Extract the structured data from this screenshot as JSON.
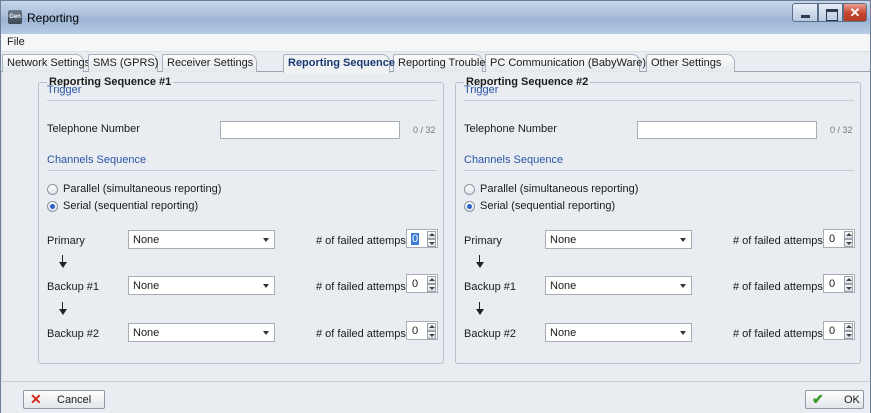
{
  "window": {
    "title": "Reporting",
    "app_icon_text": "Gen"
  },
  "menu": {
    "file": "File"
  },
  "tabs": [
    "Network Settings",
    "SMS (GPRS)",
    "Receiver Settings",
    "Reporting Sequence",
    "Reporting Trouble",
    "PC Communication (BabyWare)",
    "Other Settings"
  ],
  "active_tab": "Reporting Sequence",
  "panels": [
    {
      "title": "Reporting Sequence #1",
      "trigger_heading": "Trigger",
      "phone_label": "Telephone Number",
      "phone_value": "",
      "phone_counter": "0 / 32",
      "channels_heading": "Channels Sequence",
      "mode_parallel": "Parallel (simultaneous reporting)",
      "mode_serial": "Serial (sequential reporting)",
      "selected_mode": "serial",
      "rows": [
        {
          "label": "Primary",
          "value": "None",
          "attempts_label": "# of failed attemps",
          "attempts": "0",
          "attempts_selected": true
        },
        {
          "label": "Backup #1",
          "value": "None",
          "attempts_label": "# of failed attemps",
          "attempts": "0",
          "attempts_selected": false
        },
        {
          "label": "Backup #2",
          "value": "None",
          "attempts_label": "# of failed attemps",
          "attempts": "0",
          "attempts_selected": false
        }
      ]
    },
    {
      "title": "Reporting Sequence #2",
      "trigger_heading": "Trigger",
      "phone_label": "Telephone Number",
      "phone_value": "",
      "phone_counter": "0 / 32",
      "channels_heading": "Channels Sequence",
      "mode_parallel": "Parallel (simultaneous reporting)",
      "mode_serial": "Serial (sequential reporting)",
      "selected_mode": "serial",
      "rows": [
        {
          "label": "Primary",
          "value": "None",
          "attempts_label": "# of failed attemps",
          "attempts": "0",
          "attempts_selected": false
        },
        {
          "label": "Backup #1",
          "value": "None",
          "attempts_label": "# of failed attemps",
          "attempts": "0",
          "attempts_selected": false
        },
        {
          "label": "Backup #2",
          "value": "None",
          "attempts_label": "# of failed attemps",
          "attempts": "0",
          "attempts_selected": false
        }
      ]
    }
  ],
  "buttons": {
    "cancel": "Cancel",
    "ok": "OK"
  },
  "icons": {
    "cancel": "close-x-icon",
    "ok": "checkmark-icon",
    "arrow": "arrow-down-icon"
  },
  "colors": {
    "section_heading": "#2a56a5",
    "cancel_icon": "#d42a1c",
    "ok_icon": "#3a9a2b",
    "active_tab_text": "#1a3a73"
  }
}
